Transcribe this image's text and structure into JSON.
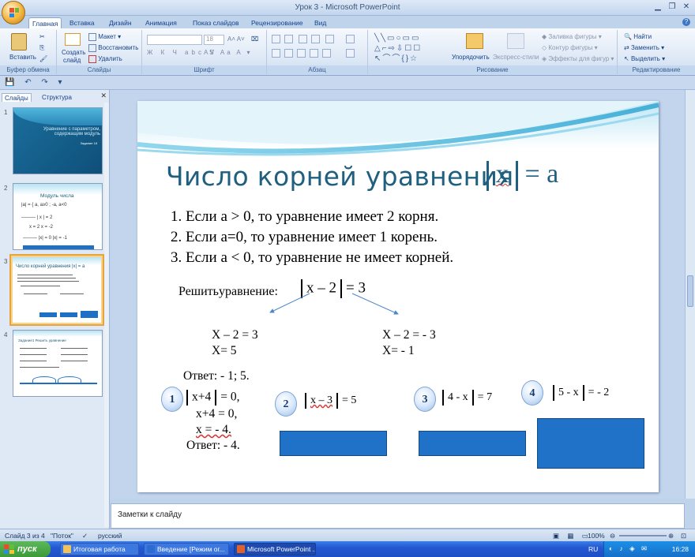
{
  "window": {
    "title": "Урок 3 - Microsoft PowerPoint"
  },
  "ribbon_tabs": [
    "Главная",
    "Вставка",
    "Дизайн",
    "Анимация",
    "Показ слайдов",
    "Рецензирование",
    "Вид"
  ],
  "ribbon": {
    "paste": "Вставить",
    "new_slide_line1": "Создать",
    "new_slide_line2": "слайд",
    "layout": "Макет",
    "reset": "Восстановить",
    "delete": "Удалить",
    "font_size": "18",
    "arrange": "Упорядочить",
    "quick_styles": "Экспресс-стили",
    "shape_fill": "Заливка фигуры",
    "shape_outline": "Контур фигуры",
    "shape_effects": "Эффекты для фигур",
    "find": "Найти",
    "replace": "Заменить",
    "select": "Выделить",
    "groups": [
      "Буфер обмена",
      "Слайды",
      "Шрифт",
      "Абзац",
      "Рисование",
      "Редактирование"
    ]
  },
  "left_pane": {
    "tabs": [
      "Слайды",
      "Структура"
    ],
    "thumbnails": [
      {
        "num": "1",
        "title": "Уравнение с параметром, содержащим модуль",
        "subtitle": "Задание 18"
      },
      {
        "num": "2",
        "title": "Модуль числа"
      },
      {
        "num": "3",
        "title": "Число корней уравнения |x| = a"
      },
      {
        "num": "4",
        "title": "Задание1 Решить уравнение"
      }
    ]
  },
  "slide": {
    "title": "Число корней уравнения",
    "title_eq_x": "x",
    "title_eq_rest": "= a",
    "rules": [
      "1. Если a > 0, то уравнение имеет  2 корня.",
      "2. Если a=0, то уравнение имеет  1  корень.",
      "3. Если a < 0, то уравнение не имеет корней."
    ],
    "solve_label": "Решитьуравнение:",
    "solve_inner": "x – 2",
    "solve_rhs": "= 3",
    "left_case": [
      "X – 2 = 3",
      "X= 5"
    ],
    "right_case": [
      "X – 2 =  - 3",
      "X= - 1"
    ],
    "answer1": "Ответ:  - 1;  5.",
    "tasks": [
      {
        "num": "1",
        "eq_inner": "x+4",
        "eq_rhs": "=  0,"
      },
      {
        "num": "2",
        "eq_inner": "x – 3",
        "eq_rhs": "= 5"
      },
      {
        "num": "3",
        "eq_inner": "4 -  x",
        "eq_rhs": "= 7"
      },
      {
        "num": "4",
        "eq_inner": "5 -  x",
        "eq_rhs": "= - 2"
      }
    ],
    "task1_steps": [
      "x+4 =   0,",
      "x =  - 4."
    ],
    "answer2": "Ответ:  - 4."
  },
  "notes_placeholder": "Заметки к слайду",
  "status": {
    "slide_info": "Слайд 3 из 4",
    "theme": "\"Поток\"",
    "language": "русский",
    "zoom": "100%"
  },
  "taskbar": {
    "start": "пуск",
    "tasks": [
      "Итоговая работа",
      "Введение [Режим ог...",
      "Microsoft PowerPoint ..."
    ],
    "lang": "RU",
    "clock": "16:28"
  },
  "colors": {
    "title_color": "#1f5f7f",
    "box_blue": "#1f72c8",
    "ribbon_text": "#15428b"
  }
}
